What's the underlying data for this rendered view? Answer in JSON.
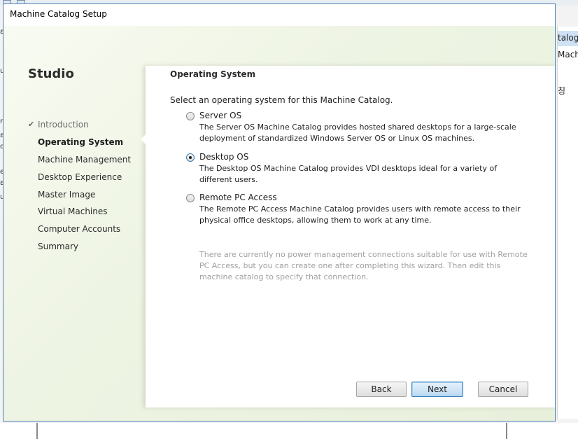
{
  "dialog": {
    "title": "Machine Catalog Setup",
    "brand": "Studio"
  },
  "nav": {
    "items": [
      {
        "label": "Introduction",
        "state": "done"
      },
      {
        "label": "Operating System",
        "state": "current"
      },
      {
        "label": "Machine Management",
        "state": "pending"
      },
      {
        "label": "Desktop Experience",
        "state": "pending"
      },
      {
        "label": "Master Image",
        "state": "pending"
      },
      {
        "label": "Virtual Machines",
        "state": "pending"
      },
      {
        "label": "Computer Accounts",
        "state": "pending"
      },
      {
        "label": "Summary",
        "state": "pending"
      }
    ],
    "check_glyph": "✔"
  },
  "main": {
    "heading": "Operating System",
    "instruction": "Select an operating system for this Machine Catalog.",
    "options": [
      {
        "label": "Server OS",
        "description": "The Server OS Machine Catalog provides hosted shared desktops for a large-scale deployment of standardized Windows Server OS or Linux OS machines.",
        "selected": false
      },
      {
        "label": "Desktop OS",
        "description": "The Desktop OS Machine Catalog provides VDI desktops ideal for a variety of different users.",
        "selected": true
      },
      {
        "label": "Remote PC Access",
        "description": "The Remote PC Access Machine Catalog provides users with remote access to their physical office desktops, allowing them to work at any time.",
        "selected": false
      }
    ],
    "note": "There are currently no power management connections suitable for use with Remote PC Access, but you can create one after completing this wizard. Then edit this machine catalog to specify that connection."
  },
  "buttons": {
    "back": "Back",
    "next": "Next",
    "cancel": "Cancel"
  },
  "background": {
    "right_items": [
      "talogs",
      "Mach",
      "칭"
    ],
    "left_chars": [
      "ε",
      "u",
      "r",
      "ε",
      "o",
      "e",
      "ε",
      "u"
    ]
  },
  "colors": {
    "accent": "#3e7cb6",
    "nav_done": "#6b6b6b",
    "note": "#a0a0a0"
  }
}
